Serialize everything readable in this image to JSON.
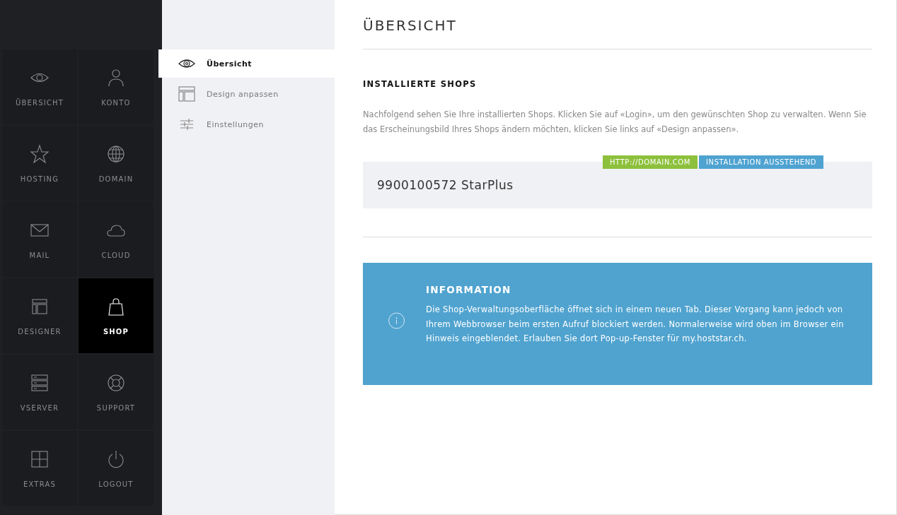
{
  "main_nav": [
    {
      "label": "ÜBERSICHT",
      "kind": "eye",
      "selected": false
    },
    {
      "label": "KONTO",
      "kind": "person",
      "selected": false
    },
    {
      "label": "HOSTING",
      "kind": "star",
      "selected": false
    },
    {
      "label": "DOMAIN",
      "kind": "globe",
      "selected": false
    },
    {
      "label": "MAIL",
      "kind": "envelope",
      "selected": false
    },
    {
      "label": "CLOUD",
      "kind": "cloud",
      "selected": false
    },
    {
      "label": "DESIGNER",
      "kind": "layout",
      "selected": false
    },
    {
      "label": "SHOP",
      "kind": "bag",
      "selected": true
    },
    {
      "label": "VSERVER",
      "kind": "server",
      "selected": false
    },
    {
      "label": "SUPPORT",
      "kind": "lifebuoy",
      "selected": false
    },
    {
      "label": "EXTRAS",
      "kind": "plus",
      "selected": false
    },
    {
      "label": "LOGOUT",
      "kind": "power",
      "selected": false
    }
  ],
  "sub_nav": [
    {
      "label": "Übersicht",
      "kind": "eye",
      "selected": true
    },
    {
      "label": "Design anpassen",
      "kind": "layout",
      "selected": false
    },
    {
      "label": "Einstellungen",
      "kind": "sliders",
      "selected": false
    }
  ],
  "page_title": "ÜBERSICHT",
  "section_title": "INSTALLIERTE SHOPS",
  "intro": "Nachfolgend sehen Sie Ihre installierten Shops. Klicken Sie auf «Login», um den gewünschten Shop zu verwalten. Wenn Sie das Erscheinungsbild Ihres Shops ändern möchten, klicken Sie links auf «Design anpassen».",
  "shops": [
    {
      "name": "9900100572 StarPlus",
      "tags": [
        {
          "label": "HTTP://DOMAIN.COM",
          "color": "#8dc03c"
        },
        {
          "label": "INSTALLATION AUSSTEHEND",
          "color": "#4fa3d1"
        }
      ]
    }
  ],
  "info": {
    "title": "INFORMATION",
    "text": "Die Shop-Verwaltungsoberfläche öffnet sich in einem neuen Tab. Dieser Vorgang kann jedoch von Ihrem Webbrowser beim ersten Aufruf blockiert werden. Normalerweise wird oben im Browser ein Hinweis eingeblendet. Erlauben Sie dort Pop-up-Fenster für my.hoststar.ch."
  }
}
